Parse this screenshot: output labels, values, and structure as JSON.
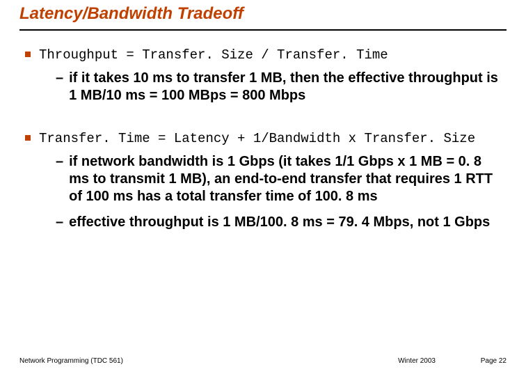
{
  "title": "Latency/Bandwidth Tradeoff",
  "bullet1": "Throughput = Transfer. Size / Transfer. Time",
  "sub1": "if it takes 10 ms to transfer 1 MB, then the effective throughput is 1 MB/10 ms = 100 MBps = 800 Mbps",
  "bullet2": "Transfer. Time = Latency + 1/Bandwidth x Transfer. Size",
  "sub2a": "if network bandwidth is 1 Gbps (it takes 1/1 Gbps x 1 MB = 0. 8 ms to transmit 1 MB), an end-to-end transfer that requires 1 RTT of 100 ms has a total transfer time of 100. 8 ms",
  "sub2b": "effective throughput is 1 MB/100. 8 ms = 79. 4 Mbps, not 1 Gbps",
  "footer": {
    "left": "Network Programming (TDC 561)",
    "center": "Winter 2003",
    "right": "Page 22"
  }
}
